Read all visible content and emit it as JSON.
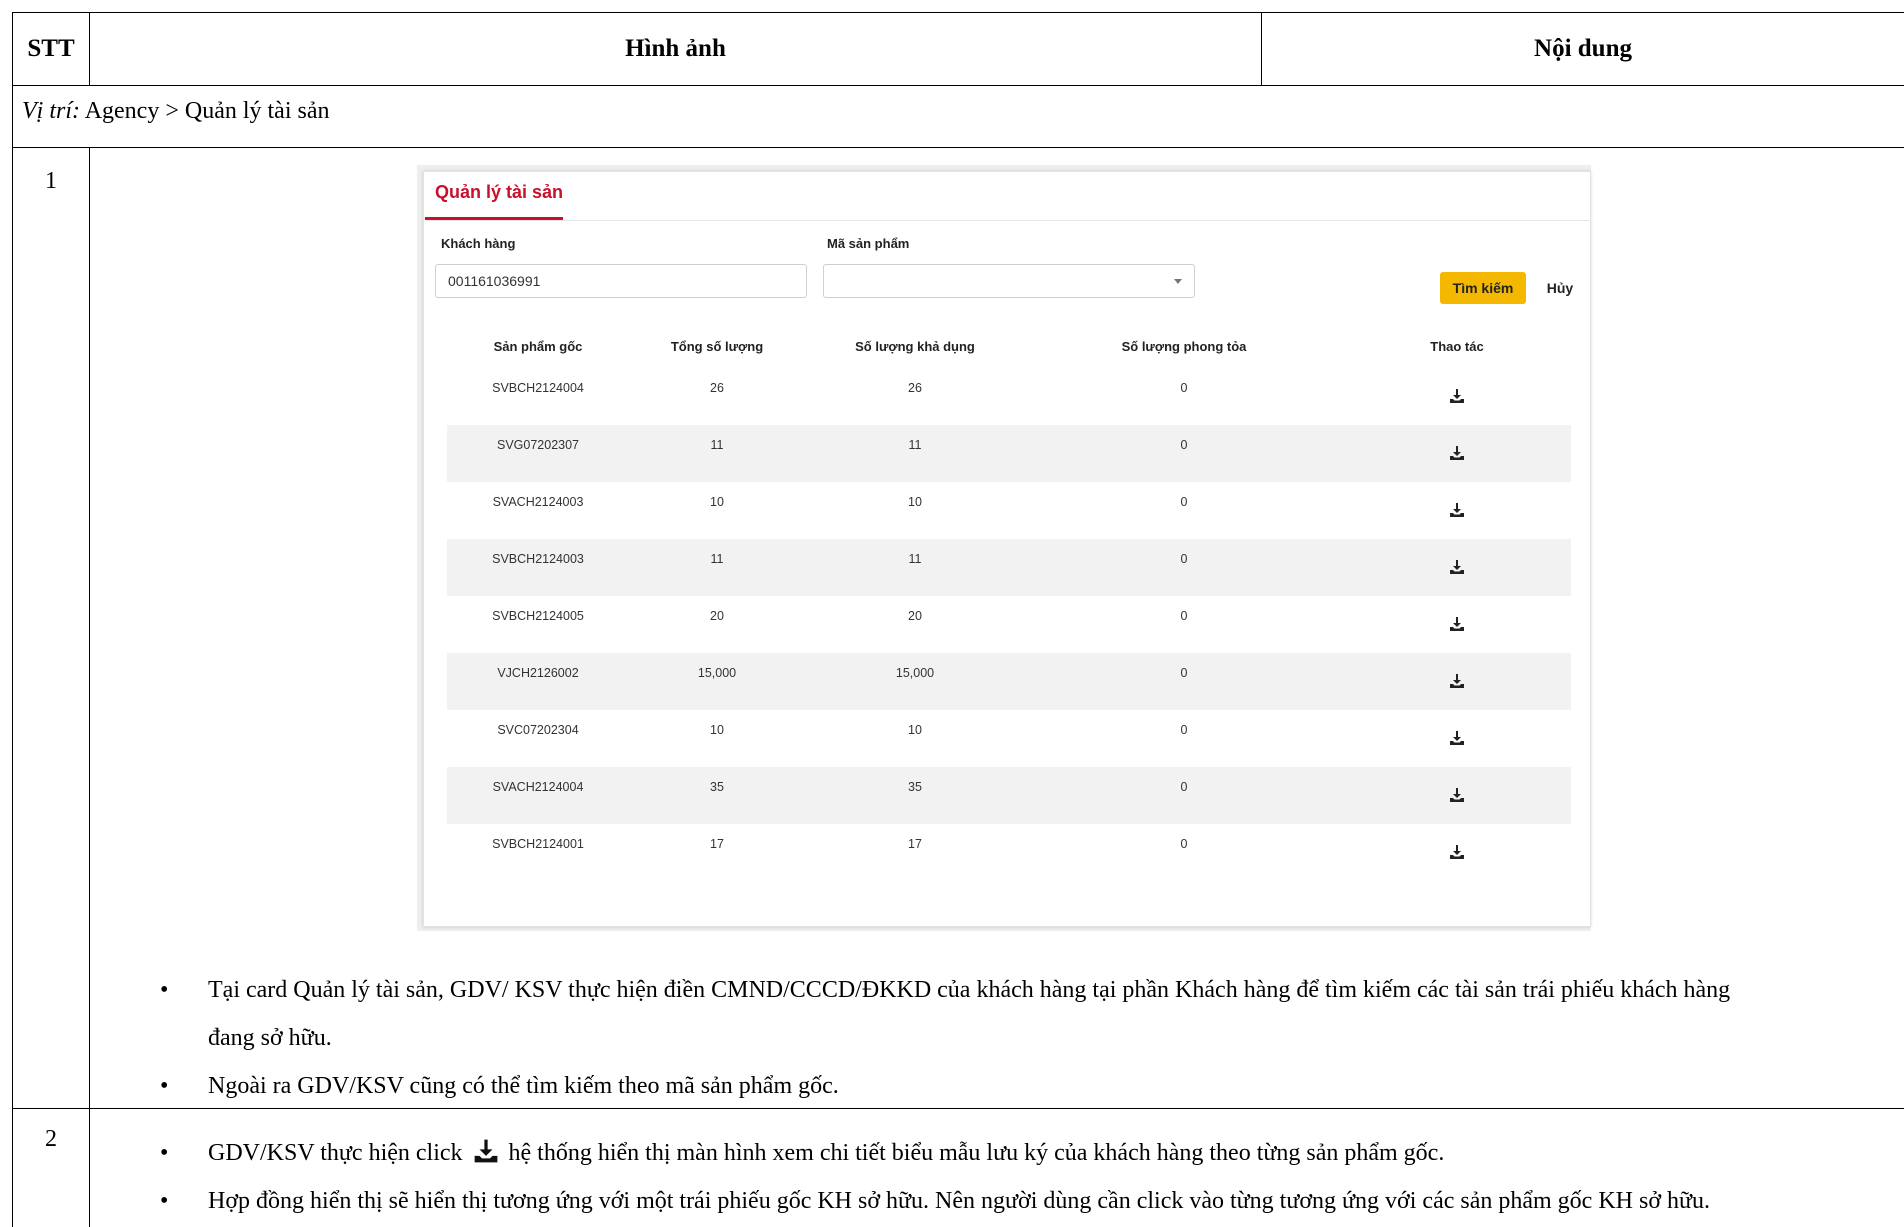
{
  "header": {
    "stt": "STT",
    "image": "Hình ảnh",
    "content": "Nội dung"
  },
  "location": {
    "prefix": "Vị trí:",
    "path": "Agency > Quản lý tài sản"
  },
  "rows": [
    {
      "number": "1",
      "bullets": [
        "Tại card Quản lý tài sản, GDV/ KSV thực hiện điền CMND/CCCD/ĐKKD của khách hàng tại phần Khách hàng để tìm kiếm các tài sản trái phiếu khách hàng",
        "đang sở hữu.",
        "Ngoài ra GDV/KSV cũng có thể tìm kiếm theo mã sản phẩm gốc."
      ]
    },
    {
      "number": "2",
      "bullet1_before": "GDV/KSV thực hiện click",
      "bullet1_after": "hệ thống hiển thị màn hình xem chi tiết biểu mẫu lưu ký của khách hàng theo từng sản phẩm gốc.",
      "bullet2": "Hợp đồng hiển thị sẽ hiển thị tương ứng với một trái phiếu gốc KH sở hữu. Nên người dùng cần click vào từng tương ứng với các sản phẩm gốc KH sở hữu."
    }
  ],
  "ui": {
    "title": "Quản lý tài sản",
    "customer_label": "Khách hàng",
    "customer_value": "001161036991",
    "product_label": "Mã sản phẩm",
    "product_value": "",
    "search_button": "Tìm kiếm",
    "cancel_button": "Hủy",
    "columns": [
      "Sản phẩm gốc",
      "Tổng số lượng",
      "Số lượng khả dụng",
      "Số lượng phong tỏa",
      "Thao tác"
    ],
    "action_icon": "download-icon",
    "table": [
      [
        "SVBCH2124004",
        "26",
        "26",
        "0"
      ],
      [
        "SVG07202307",
        "11",
        "11",
        "0"
      ],
      [
        "SVACH2124003",
        "10",
        "10",
        "0"
      ],
      [
        "SVBCH2124003",
        "11",
        "11",
        "0"
      ],
      [
        "SVBCH2124005",
        "20",
        "20",
        "0"
      ],
      [
        "VJCH2126002",
        "15,000",
        "15,000",
        "0"
      ],
      [
        "SVC07202304",
        "10",
        "10",
        "0"
      ],
      [
        "SVACH2124004",
        "35",
        "35",
        "0"
      ],
      [
        "SVBCH2124001",
        "17",
        "17",
        "0"
      ]
    ],
    "colors": {
      "accent": "#c8102e",
      "search_button": "#f5b800",
      "row_alt": "#f2f2f2"
    }
  }
}
